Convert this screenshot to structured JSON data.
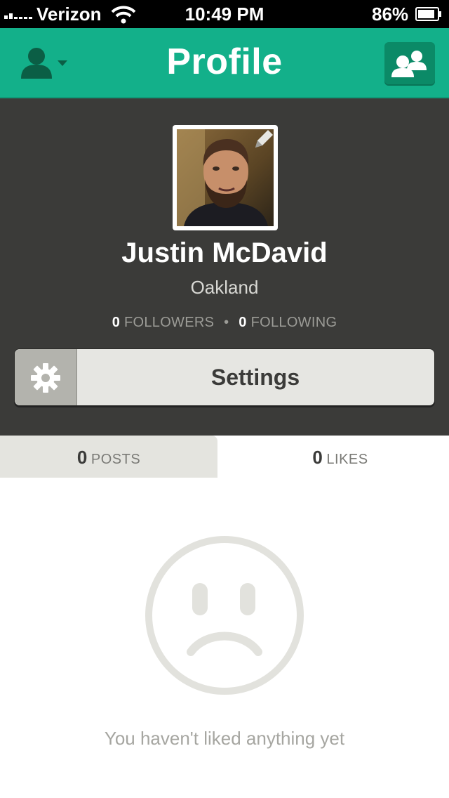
{
  "status_bar": {
    "carrier": "Verizon",
    "time": "10:49 PM",
    "battery_percent": "86%",
    "icons": [
      "signal-icon",
      "wifi-icon",
      "battery-icon"
    ]
  },
  "header": {
    "title": "Profile",
    "left_icon": "user-menu-icon",
    "right_icon": "friends-icon",
    "color": "#13b08a"
  },
  "profile": {
    "name": "Justin McDavid",
    "location": "Oakland",
    "followers_count": "0",
    "followers_label": "FOLLOWERS",
    "following_count": "0",
    "following_label": "FOLLOWING",
    "stat_separator": "•",
    "edit_icon": "pencil-icon"
  },
  "settings": {
    "label": "Settings",
    "icon": "gear-icon"
  },
  "tabs": [
    {
      "count": "0",
      "label": "POSTS",
      "active": false
    },
    {
      "count": "0",
      "label": "LIKES",
      "active": true
    }
  ],
  "empty_state": {
    "icon": "sad-face-icon",
    "message": "You haven't liked anything yet"
  }
}
